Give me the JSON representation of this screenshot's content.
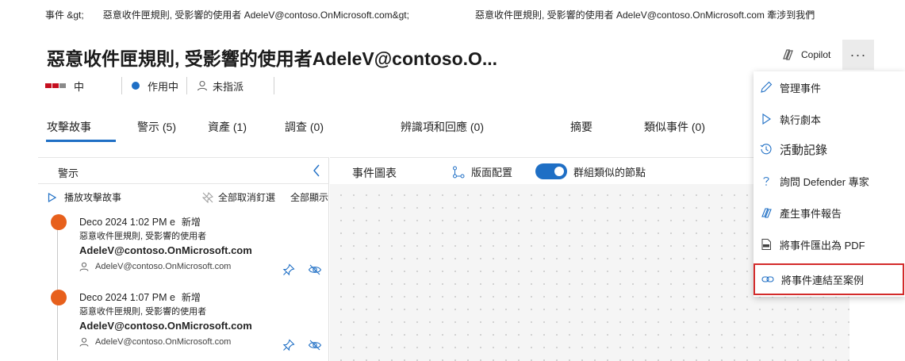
{
  "breadcrumb": {
    "left": "事件 &gt;",
    "left_item": "惡意收件匣規則, 受影響的使用者 AdeleV@contoso.OnMicrosoft.com&gt;",
    "right": "惡意收件匣規則, 受影響的使用者 AdeleV@contoso.OnMicrosoft.com 牽涉到我們"
  },
  "header": {
    "title": "惡意收件匣規則, 受影響的使用者AdeleV@contoso.O...",
    "copilot_label": "Copilot",
    "more_label": "···"
  },
  "status": {
    "severity": "中",
    "severity_colors": [
      "#c50f1f",
      "#c50f1f",
      "#8a8a8a"
    ],
    "state": "作用中",
    "state_color": "#1f6fc5",
    "assignee": "未指派"
  },
  "tabs": [
    {
      "label": "攻擊故事"
    },
    {
      "label": "警示 (5)"
    },
    {
      "label": "資產 (1)"
    },
    {
      "label": "調查 (0)"
    },
    {
      "label": "辨識項和回應 (0)"
    },
    {
      "label": "摘要"
    },
    {
      "label": "類似事件 (0)"
    }
  ],
  "alerts_panel": {
    "title": "警示",
    "play_label": "播放攻擊故事",
    "unpin_all_label": "全部取消釘選",
    "show_all_label": "全部顯示",
    "items": [
      {
        "time": "Deco 2024 1:02 PM e",
        "status": "新增",
        "name": "惡意收件匣規則, 受影響的使用者",
        "account_bold": "AdeleV@contoso.OnMicrosoft.com",
        "user": "AdeleV@contoso.OnMicrosoft.com"
      },
      {
        "time": "Deco 2024 1:07 PM e",
        "status": "新增",
        "name": "惡意收件匣規則, 受影響的使用者",
        "account_bold": "AdeleV@contoso.OnMicrosoft.com",
        "user": "AdeleV@contoso.OnMicrosoft.com"
      }
    ]
  },
  "graph": {
    "title": "事件圖表",
    "layout_label": "版面配置",
    "group_label": "群組類似的節點",
    "group_enabled": true
  },
  "menu": {
    "items": [
      {
        "label": "管理事件",
        "icon": "pencil-icon"
      },
      {
        "label": "執行劇本",
        "icon": "play-icon"
      },
      {
        "label": "活動記錄",
        "icon": "history-icon"
      },
      {
        "label": "詢問 Defender 專家",
        "icon": "question-icon"
      },
      {
        "label": "產生事件報告",
        "icon": "copilot-icon"
      },
      {
        "label": "將事件匯出為 PDF",
        "icon": "pdf-icon"
      },
      {
        "label": "將事件連結至案例",
        "icon": "link-icon",
        "highlighted": true
      }
    ]
  }
}
